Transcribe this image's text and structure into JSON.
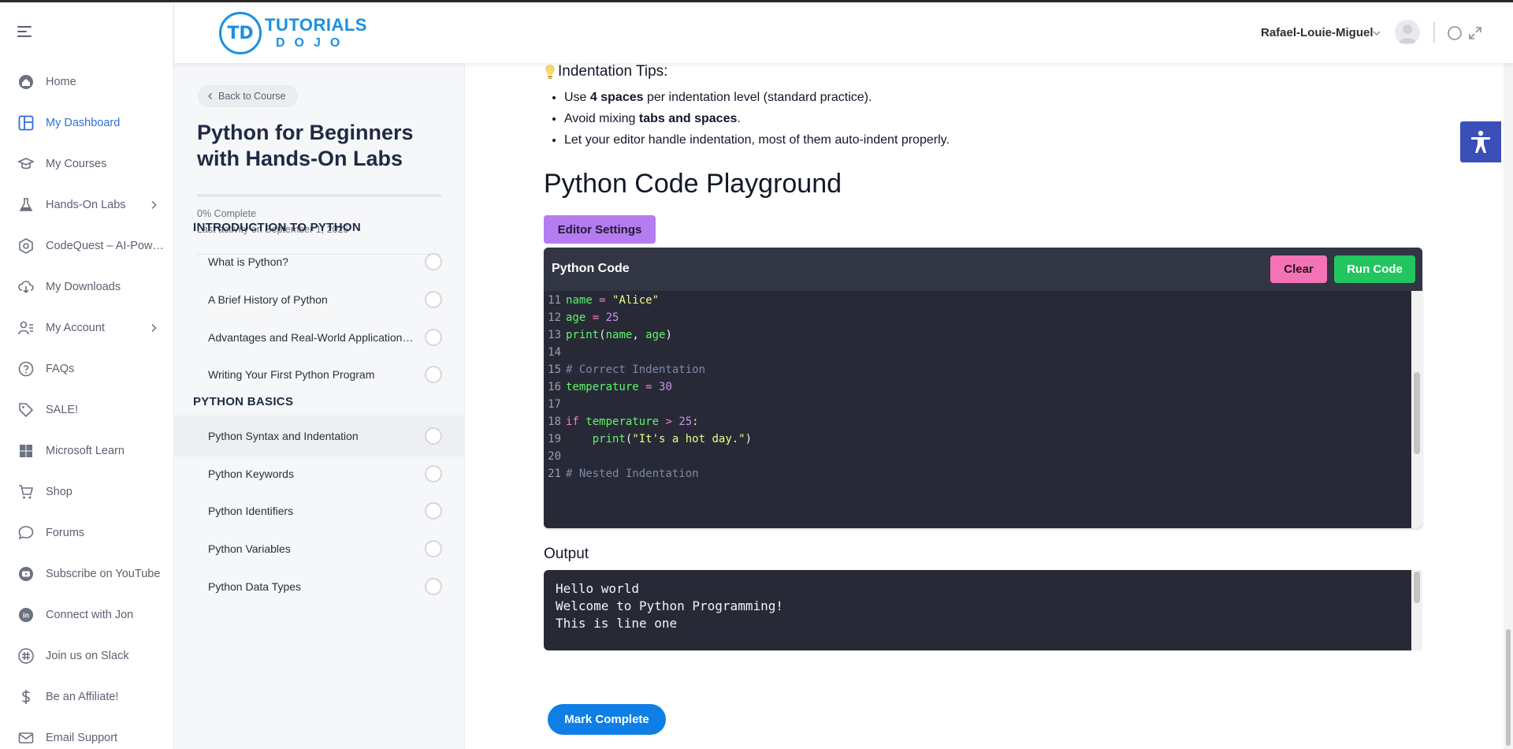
{
  "colors": {
    "brand": "#1a8fe3",
    "nav_active": "#2f6fd6",
    "editor_bg": "#272a36",
    "run": "#22c55e",
    "clear": "#f472b6",
    "settings": "#b57cf2"
  },
  "header": {
    "logo_primary": "TUTORIALS",
    "logo_secondary": "DOJO",
    "logo_mark": "TD",
    "user_name": "Rafael-Louie-Miguel"
  },
  "nav": {
    "items": [
      {
        "label": "Home",
        "icon": "home-icon"
      },
      {
        "label": "My Dashboard",
        "icon": "dashboard-icon",
        "active": true
      },
      {
        "label": "My Courses",
        "icon": "graduation-cap-icon"
      },
      {
        "label": "Hands-On Labs",
        "icon": "flask-icon",
        "has_children": true
      },
      {
        "label": "CodeQuest – AI-Powered Programming",
        "icon": "codequest-icon"
      },
      {
        "label": "My Downloads",
        "icon": "download-cloud-icon"
      },
      {
        "label": "My Account",
        "icon": "user-list-icon",
        "has_children": true
      },
      {
        "label": "FAQs",
        "icon": "question-icon"
      },
      {
        "label": "SALE!",
        "icon": "tag-icon"
      },
      {
        "label": "Microsoft Learn",
        "icon": "windows-icon"
      },
      {
        "label": "Shop",
        "icon": "cart-icon"
      },
      {
        "label": "Forums",
        "icon": "chat-icon"
      },
      {
        "label": "Subscribe on YouTube",
        "icon": "youtube-icon"
      },
      {
        "label": "Connect with Jon",
        "icon": "linkedin-icon"
      },
      {
        "label": "Join us on Slack",
        "icon": "slack-icon"
      },
      {
        "label": "Be an Affiliate!",
        "icon": "dollar-icon"
      },
      {
        "label": "Email Support",
        "icon": "mail-icon"
      }
    ]
  },
  "course": {
    "back_label": "Back to Course",
    "title": "Python for Beginners with Hands-On Labs",
    "progress": 0,
    "progress_text": "0% Complete",
    "activity_text": "Last activity on September 1, 2025",
    "sections": [
      {
        "title": "INTRODUCTION TO PYTHON",
        "lessons": [
          {
            "label": "What is Python?"
          },
          {
            "label": "A Brief History of Python"
          },
          {
            "label": "Advantages and Real-World Applications of Python"
          },
          {
            "label": "Writing Your First Python Program"
          }
        ]
      },
      {
        "title": "PYTHON BASICS",
        "lessons": [
          {
            "label": "Python Syntax and Indentation",
            "current": true
          },
          {
            "label": "Python Keywords"
          },
          {
            "label": "Python Identifiers"
          },
          {
            "label": "Python Variables"
          },
          {
            "label": "Python Data Types"
          }
        ]
      }
    ]
  },
  "main": {
    "tips_title": "Indentation Tips:",
    "tips": [
      {
        "pre": "Use ",
        "bold": "4 spaces",
        "post": " per indentation level (standard practice)."
      },
      {
        "pre": "Avoid mixing ",
        "bold": "tabs and spaces",
        "post": "."
      },
      {
        "pre": "Let your editor handle indentation, most of them auto-indent properly.",
        "bold": "",
        "post": ""
      }
    ],
    "playground_title": "Python Code Playground",
    "editor_settings_label": "Editor Settings",
    "code_title": "Python Code",
    "clear_label": "Clear",
    "run_label": "Run Code",
    "code_lines": [
      {
        "n": "11",
        "tokens": [
          [
            "var",
            "name"
          ],
          [
            "op",
            " = "
          ],
          [
            "str",
            "\"Alice\""
          ]
        ]
      },
      {
        "n": "12",
        "tokens": [
          [
            "var",
            "age"
          ],
          [
            "op",
            " = "
          ],
          [
            "num",
            "25"
          ]
        ]
      },
      {
        "n": "13",
        "tokens": [
          [
            "fn",
            "print"
          ],
          [
            "pun",
            "("
          ],
          [
            "var",
            "name"
          ],
          [
            "pun",
            ", "
          ],
          [
            "var",
            "age"
          ],
          [
            "pun",
            ")"
          ]
        ]
      },
      {
        "n": "14",
        "tokens": []
      },
      {
        "n": "15",
        "tokens": [
          [
            "com",
            "# Correct Indentation"
          ]
        ]
      },
      {
        "n": "16",
        "tokens": [
          [
            "var",
            "temperature"
          ],
          [
            "op",
            " = "
          ],
          [
            "num",
            "30"
          ]
        ]
      },
      {
        "n": "17",
        "tokens": []
      },
      {
        "n": "18",
        "tokens": [
          [
            "kw",
            "if "
          ],
          [
            "var",
            "temperature"
          ],
          [
            "op",
            " > "
          ],
          [
            "num",
            "25"
          ],
          [
            "pun",
            ":"
          ]
        ]
      },
      {
        "n": "19",
        "tokens": [
          [
            "pun",
            "    "
          ],
          [
            "fn",
            "print"
          ],
          [
            "pun",
            "("
          ],
          [
            "str",
            "\"It's a hot day.\""
          ],
          [
            "pun",
            ")"
          ]
        ]
      },
      {
        "n": "20",
        "tokens": []
      },
      {
        "n": "21",
        "tokens": [
          [
            "com",
            "# Nested Indentation"
          ]
        ]
      }
    ],
    "output_label": "Output",
    "output_lines": [
      "Hello world",
      "Welcome to Python Programming!",
      "This is line one"
    ],
    "mark_complete_label": "Mark Complete"
  }
}
